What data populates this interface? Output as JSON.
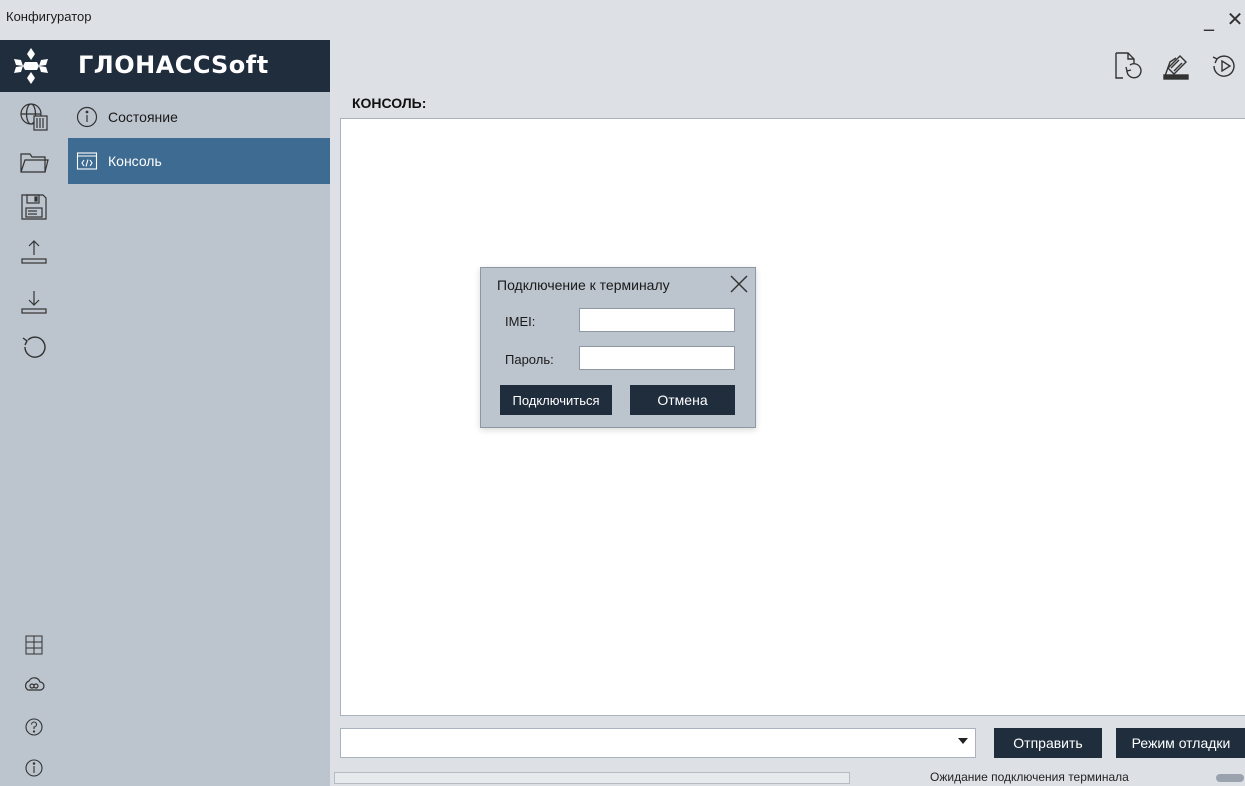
{
  "window": {
    "title": "Конфигуратор",
    "minimize_glyph": "_",
    "close_glyph": "✕"
  },
  "brand": {
    "name": "ГЛОНАССSoft",
    "logo_icon": "snowflake-logo-icon"
  },
  "toolbar": {
    "buttons": [
      {
        "icon": "file-refresh-icon"
      },
      {
        "icon": "device-settings-icon"
      },
      {
        "icon": "play-reload-icon"
      }
    ]
  },
  "rail": {
    "top_icons": [
      "globe-device-icon",
      "folder-open-icon",
      "save-icon",
      "upload-icon",
      "download-icon",
      "undo-icon"
    ],
    "bottom_icons": [
      "grid-table-icon",
      "cloud-link-icon",
      "help-icon",
      "info-icon"
    ]
  },
  "nav": {
    "items": [
      {
        "label": "Состояние",
        "icon": "info-circle-icon",
        "active": false
      },
      {
        "label": "Консоль",
        "icon": "code-window-icon",
        "active": true
      }
    ]
  },
  "console": {
    "title": "КОНСОЛЬ:",
    "command_value": "",
    "send_label": "Отправить",
    "debug_label": "Режим отладки"
  },
  "status": {
    "text": "Ожидание подключения терминала",
    "progress": 0
  },
  "dialog": {
    "title": "Подключение к терминалу",
    "imei_label": "IMEI:",
    "imei_value": "",
    "password_label": "Пароль:",
    "password_value": "",
    "connect_label": "Подключиться",
    "cancel_label": "Отмена"
  },
  "colors": {
    "brand_bar": "#1f2d3d",
    "panel": "#bcc4ce",
    "nav_active": "#3e6b91",
    "chrome": "#dde1e6",
    "button_dark": "#1f2d3d"
  }
}
